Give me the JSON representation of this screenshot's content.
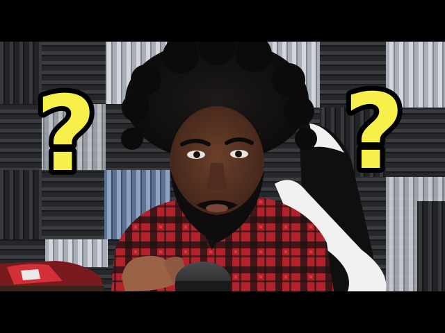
{
  "image": {
    "subject": "person",
    "question_marks": [
      {
        "glyph": "?",
        "fill": "#f7f04a",
        "stroke": "#000000"
      },
      {
        "glyph": "?",
        "fill": "#f7f04a",
        "stroke": "#000000"
      }
    ],
    "colors": {
      "foam_dark": "#2a2b2e",
      "foam_light": "#bfc4cc",
      "foam_blue": "#6f86a8",
      "shirt_red": "#c0232a",
      "skin": "#5a3524",
      "hair": "#141212",
      "chair_white": "#f1f1f1"
    }
  }
}
